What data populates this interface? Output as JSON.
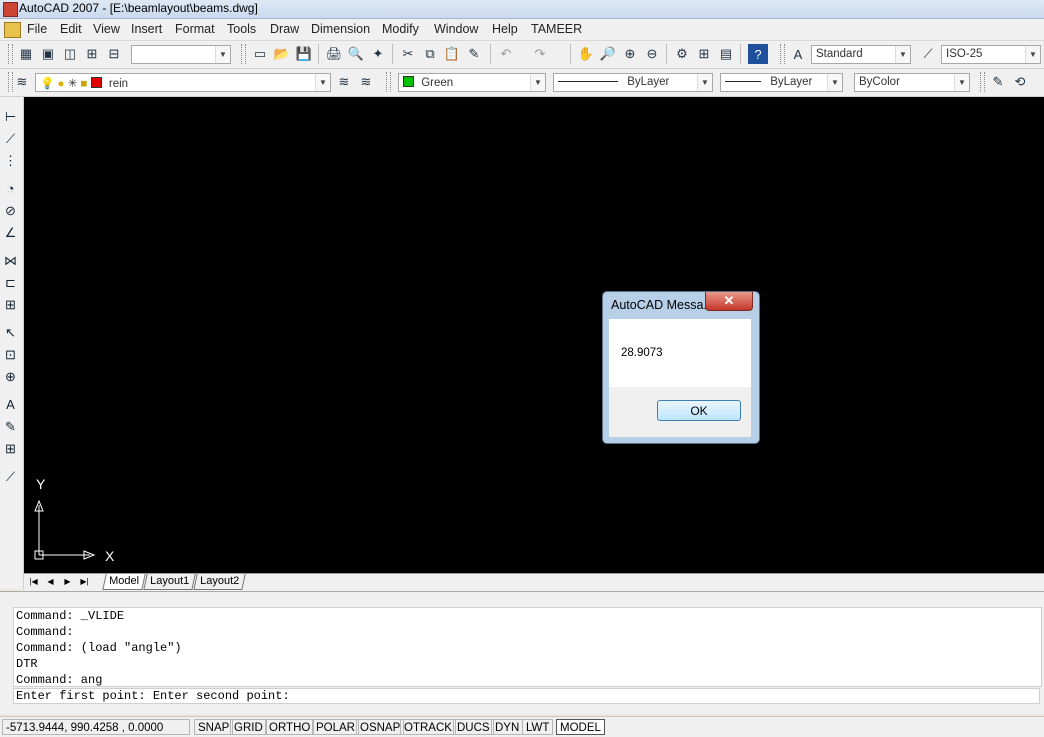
{
  "window": {
    "title": "AutoCAD 2007 - [E:\\beamlayout\\beams.dwg]"
  },
  "menu": [
    "File",
    "Edit",
    "View",
    "Insert",
    "Format",
    "Tools",
    "Draw",
    "Dimension",
    "Modify",
    "Window",
    "Help",
    "TAMEER"
  ],
  "toolbar1": {
    "workspace_combo": "",
    "text_style": "Standard",
    "dim_style": "ISO-25"
  },
  "toolbar2": {
    "layer": "rein",
    "color": "Green",
    "color_hex": "#00c000",
    "layer_color_hex": "#e00000",
    "linetype": "ByLayer",
    "lineweight": "ByLayer",
    "plotstyle": "ByColor"
  },
  "ucs": {
    "x_label": "X",
    "y_label": "Y"
  },
  "tabs": [
    "Model",
    "Layout1",
    "Layout2"
  ],
  "command_history": [
    "Command: _VLIDE",
    "Command:",
    "Command: (load \"angle\")",
    "DTR",
    "Command: ang"
  ],
  "command_prompt": "Enter first point: Enter second point:",
  "status": {
    "coords": "-5713.9444, 990.4258 , 0.0000",
    "buttons": [
      {
        "label": "SNAP",
        "on": false
      },
      {
        "label": "GRID",
        "on": false
      },
      {
        "label": "ORTHO",
        "on": false
      },
      {
        "label": "POLAR",
        "on": false
      },
      {
        "label": "OSNAP",
        "on": false
      },
      {
        "label": "OTRACK",
        "on": false
      },
      {
        "label": "DUCS",
        "on": false
      },
      {
        "label": "DYN",
        "on": false
      },
      {
        "label": "LWT",
        "on": false
      },
      {
        "label": "MODEL",
        "on": true
      }
    ]
  },
  "dialog": {
    "title": "AutoCAD Messa...",
    "message": "28.9073",
    "ok_label": "OK",
    "close_glyph": "✕"
  }
}
